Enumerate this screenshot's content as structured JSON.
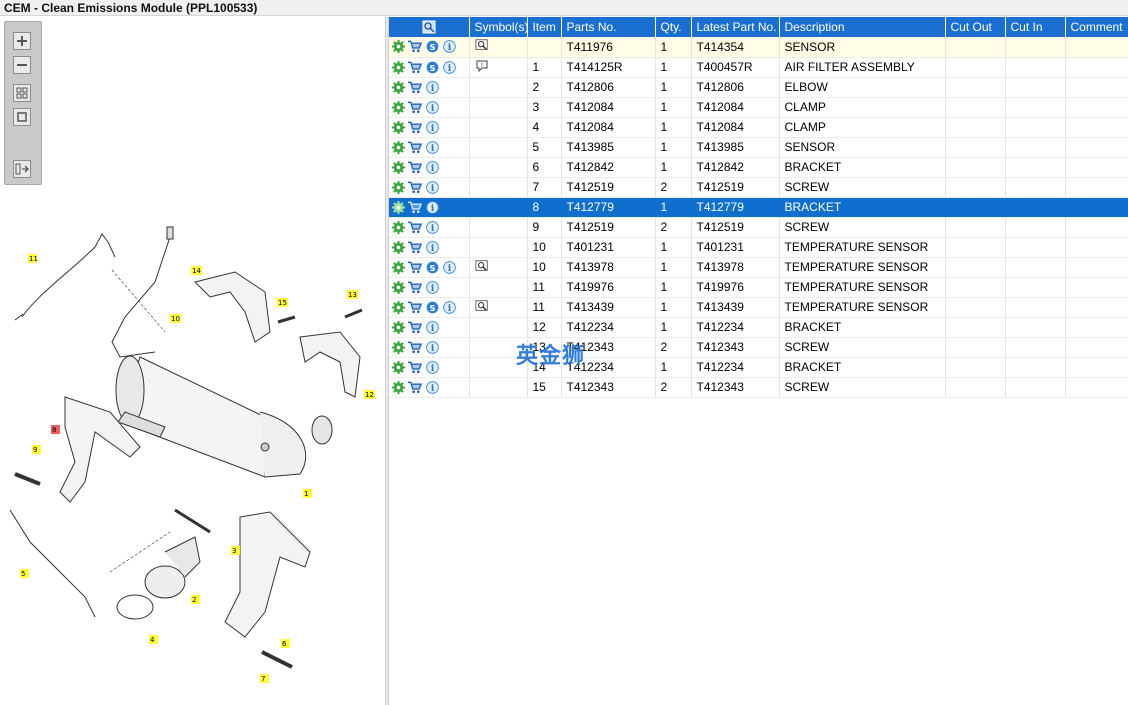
{
  "window": {
    "title": "CEM - Clean Emissions Module (PPL100533)"
  },
  "toolbox": {
    "tools": [
      "zoom-in-icon",
      "zoom-out-icon",
      "fit-grid-icon",
      "actual-size-icon",
      "toggle-panel-icon"
    ]
  },
  "diagram": {
    "callouts": [
      "11",
      "10",
      "14",
      "15",
      "13",
      "12",
      "8",
      "9",
      "1",
      "5",
      "3",
      "2",
      "4",
      "6",
      "7"
    ]
  },
  "table": {
    "columns": [
      "Symbol(s)",
      "Item",
      "Parts No.",
      "Qty.",
      "Latest Part No.",
      "Description",
      "Cut Out",
      "Cut In",
      "Comment"
    ],
    "rows": [
      {
        "item": "",
        "part": "T411976",
        "qty": "1",
        "latest": "T414354",
        "desc": "SENSOR",
        "s": true,
        "symbol": "magnifier-icon"
      },
      {
        "item": "1",
        "part": "T414125R",
        "qty": "1",
        "latest": "T400457R",
        "desc": "AIR FILTER ASSEMBLY",
        "s": true,
        "symbol": "note-icon"
      },
      {
        "item": "2",
        "part": "T412806",
        "qty": "1",
        "latest": "T412806",
        "desc": "ELBOW",
        "s": false,
        "symbol": ""
      },
      {
        "item": "3",
        "part": "T412084",
        "qty": "1",
        "latest": "T412084",
        "desc": "CLAMP",
        "s": false,
        "symbol": ""
      },
      {
        "item": "4",
        "part": "T412084",
        "qty": "1",
        "latest": "T412084",
        "desc": "CLAMP",
        "s": false,
        "symbol": ""
      },
      {
        "item": "5",
        "part": "T413985",
        "qty": "1",
        "latest": "T413985",
        "desc": "SENSOR",
        "s": false,
        "symbol": ""
      },
      {
        "item": "6",
        "part": "T412842",
        "qty": "1",
        "latest": "T412842",
        "desc": "BRACKET",
        "s": false,
        "symbol": ""
      },
      {
        "item": "7",
        "part": "T412519",
        "qty": "2",
        "latest": "T412519",
        "desc": "SCREW",
        "s": false,
        "symbol": ""
      },
      {
        "item": "8",
        "part": "T412779",
        "qty": "1",
        "latest": "T412779",
        "desc": "BRACKET",
        "s": false,
        "symbol": ""
      },
      {
        "item": "9",
        "part": "T412519",
        "qty": "2",
        "latest": "T412519",
        "desc": "SCREW",
        "s": false,
        "symbol": ""
      },
      {
        "item": "10",
        "part": "T401231",
        "qty": "1",
        "latest": "T401231",
        "desc": "TEMPERATURE SENSOR",
        "s": false,
        "symbol": ""
      },
      {
        "item": "10",
        "part": "T413978",
        "qty": "1",
        "latest": "T413978",
        "desc": "TEMPERATURE SENSOR",
        "s": true,
        "symbol": "magnifier-icon"
      },
      {
        "item": "11",
        "part": "T419976",
        "qty": "1",
        "latest": "T419976",
        "desc": "TEMPERATURE SENSOR",
        "s": false,
        "symbol": ""
      },
      {
        "item": "11",
        "part": "T413439",
        "qty": "1",
        "latest": "T413439",
        "desc": "TEMPERATURE SENSOR",
        "s": true,
        "symbol": "magnifier-icon"
      },
      {
        "item": "12",
        "part": "T412234",
        "qty": "1",
        "latest": "T412234",
        "desc": "BRACKET",
        "s": false,
        "symbol": ""
      },
      {
        "item": "13",
        "part": "T412343",
        "qty": "2",
        "latest": "T412343",
        "desc": "SCREW",
        "s": false,
        "symbol": ""
      },
      {
        "item": "14",
        "part": "T412234",
        "qty": "1",
        "latest": "T412234",
        "desc": "BRACKET",
        "s": false,
        "symbol": ""
      },
      {
        "item": "15",
        "part": "T412343",
        "qty": "2",
        "latest": "T412343",
        "desc": "SCREW",
        "s": false,
        "symbol": ""
      }
    ],
    "selected_item": "8"
  },
  "watermark": {
    "text": "英金狮"
  },
  "colors": {
    "header": "#1a6fd1",
    "selected": "#0f6fcf",
    "first_row": "#fffde6",
    "gear": "#3aa33a",
    "cart": "#1d63c6",
    "info": "#3d8fd8"
  }
}
